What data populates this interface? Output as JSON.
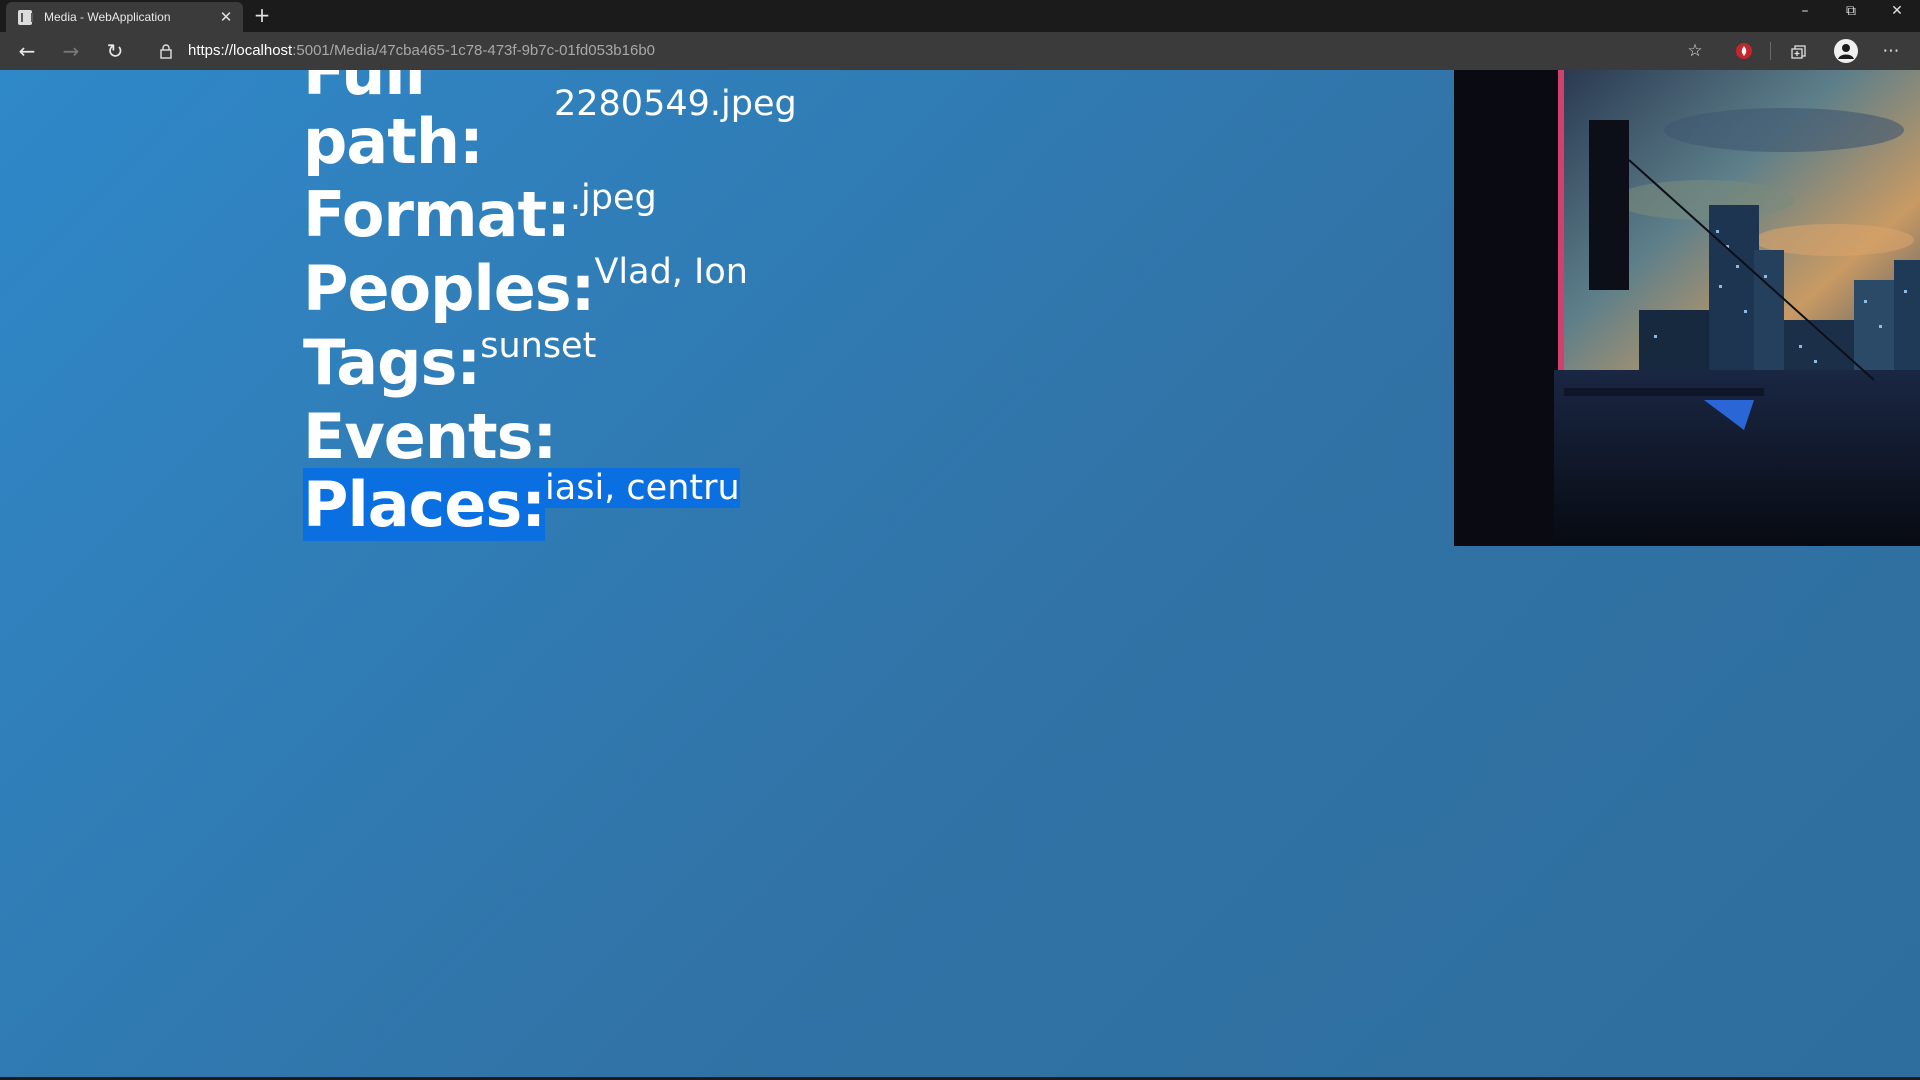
{
  "browser": {
    "tab_title": "Media - WebApplication",
    "tab_close_icon": "close-icon",
    "url_host": "https://localhost",
    "url_path": ":5001/Media/47cba465-1c78-473f-9b7c-01fd053b16b0"
  },
  "media": {
    "full_path_label_line1": "Full",
    "full_path_label_line2": "path:",
    "full_path_value": "2280549.jpeg",
    "format_label": "Format:",
    "format_value": ".jpeg",
    "peoples_label": "Peoples:",
    "peoples_value": "Vlad, Ion",
    "tags_label": "Tags:",
    "tags_value": "sunset",
    "events_label": "Events:",
    "events_value": "",
    "places_label": "Places:",
    "places_value": "iasi, centru"
  },
  "colors": {
    "page_gradient_start": "#2f88c9",
    "page_gradient_end": "#2e6e9e",
    "selection": "#0a6fe0"
  }
}
